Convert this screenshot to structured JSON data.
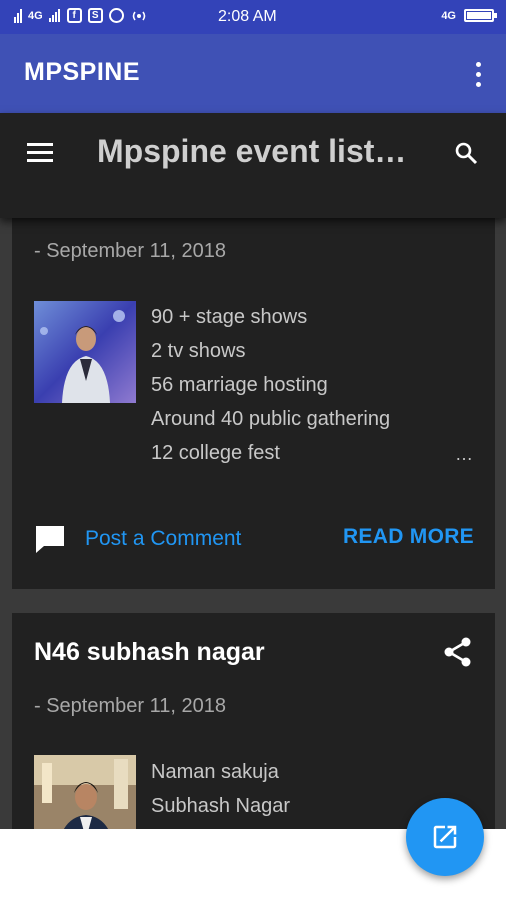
{
  "status_bar": {
    "network_left": "4G",
    "time": "2:08 AM",
    "network_right": "4G",
    "battery_level": 0.9,
    "notification_icons": [
      "signal-bars-icon",
      "facebook-icon",
      "s-app-icon",
      "whatsapp-icon",
      "broadcast-icon"
    ]
  },
  "app_bar": {
    "title": "MPSPINE"
  },
  "blog_header": {
    "title": "Mpspine event listing"
  },
  "posts": [
    {
      "date": "- September 11, 2018",
      "snippet": [
        "90 + stage shows",
        "2 tv shows",
        "56 marriage hosting",
        "Around 40 public gathering",
        "12 college fest"
      ],
      "more": "…",
      "comment_label": "Post a Comment",
      "read_more": "READ MORE"
    },
    {
      "title": "N46 subhash nagar",
      "date": "- September 11, 2018",
      "snippet": [
        "Naman sakuja",
        "Subhash Nagar"
      ]
    }
  ],
  "colors": {
    "status_bar": "#3343b8",
    "app_bar": "#3f51b5",
    "header": "#212121",
    "card": "#212121",
    "feed_bg": "#3a3a3a",
    "accent": "#2196f3"
  }
}
